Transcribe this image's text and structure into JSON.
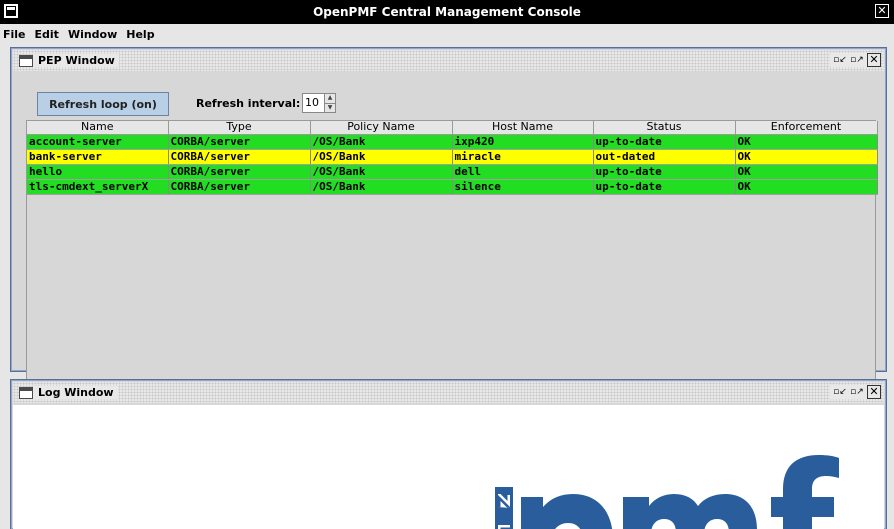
{
  "window": {
    "title": "OpenPMF Central Management Console"
  },
  "menu": [
    "File",
    "Edit",
    "Window",
    "Help"
  ],
  "pep_window": {
    "title": "PEP Window",
    "refresh_button": "Refresh loop (on)",
    "interval_label": "Refresh interval:",
    "interval_value": "10",
    "columns": [
      "Name",
      "Type",
      "Policy Name",
      "Host Name",
      "Status",
      "Enforcement"
    ],
    "rows": [
      {
        "name": "account-server",
        "type": "CORBA/server",
        "policy": "/OS/Bank",
        "host": "ixp420",
        "status": "up-to-date",
        "enforcement": "OK",
        "state": "ok"
      },
      {
        "name": "bank-server",
        "type": "CORBA/server",
        "policy": "/OS/Bank",
        "host": "miracle",
        "status": "out-dated",
        "enforcement": "OK",
        "state": "warn"
      },
      {
        "name": "hello",
        "type": "CORBA/server",
        "policy": "/OS/Bank",
        "host": "dell",
        "status": "up-to-date",
        "enforcement": "OK",
        "state": "ok"
      },
      {
        "name": "tls-cmdext_serverX",
        "type": "CORBA/server",
        "policy": "/OS/Bank",
        "host": "silence",
        "status": "up-to-date",
        "enforcement": "OK",
        "state": "ok"
      }
    ]
  },
  "log_window": {
    "title": "Log Window"
  },
  "logo": {
    "side_text": "EN",
    "main_text": "pmf",
    "color": "#2a5d9c"
  },
  "colors": {
    "row_ok": "#22dd22",
    "row_warn": "#ffff00",
    "button": "#b8cfe5"
  }
}
